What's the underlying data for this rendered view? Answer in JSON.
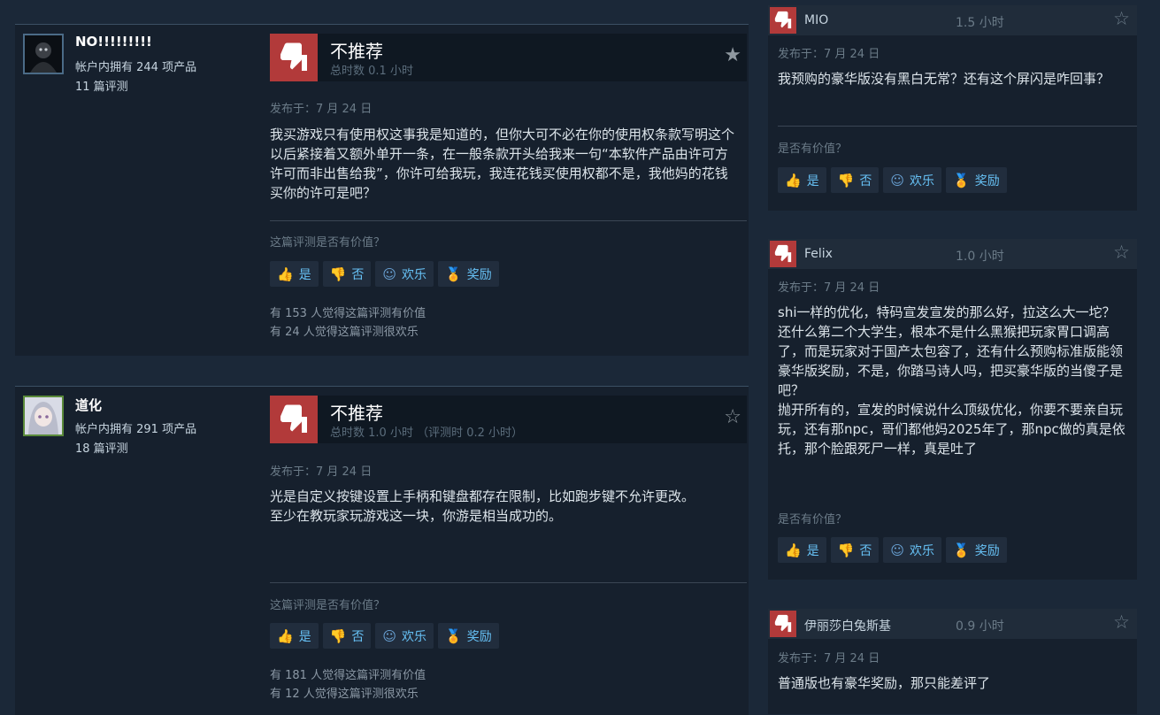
{
  "reviews": [
    {
      "user": "NO!!!!!!!!!",
      "products": "帐户内拥有 244 项产品",
      "review_count": "11 篇评测",
      "verdict": "不推荐",
      "hours": "总时数 0.1 小时",
      "posted": "发布于：7 月 24 日",
      "body": "我买游戏只有使用权这事我是知道的，但你大可不必在你的使用权条款写明这个以后紧接着又额外单开一条，在一般条款开头给我来一句“本软件产品由许可方许可而非出售给我”，你许可给我玩，我连花钱买使用权都不是，我他妈的花钱买你的许可是吧？",
      "helpful_q": "这篇评测是否有价值？",
      "helpful_stat": "有 153 人觉得这篇评测有价值",
      "funny_stat": "有 24 人觉得这篇评测很欢乐"
    },
    {
      "user": "道化",
      "products": "帐户内拥有 291 项产品",
      "review_count": "18 篇评测",
      "verdict": "不推荐",
      "hours": "总时数 1.0 小时 （评测时 0.2 小时）",
      "posted": "发布于：7 月 24 日",
      "body": "光是自定义按键设置上手柄和键盘都存在限制，比如跑步键不允许更改。\n至少在教玩家玩游戏这一块，你游是相当成功的。",
      "helpful_q": "这篇评测是否有价值？",
      "helpful_stat": "有 181 人觉得这篇评测有价值",
      "funny_stat": "有 12 人觉得这篇评测很欢乐"
    }
  ],
  "side_reviews": [
    {
      "user": "MIO",
      "hours": "1.5 小时",
      "posted": "发布于：7 月 24 日",
      "body": "我预购的豪华版没有黑白无常？还有这个屏闪是咋回事？",
      "helpful_q": "是否有价值？"
    },
    {
      "user": "Felix",
      "hours": "1.0 小时",
      "posted": "发布于：7 月 24 日",
      "body": "shi一样的优化，特码宣发宣发的那么好，拉这么大一坨？还什么第二个大学生，根本不是什么黑猴把玩家胃口调高了，而是玩家对于国产太包容了，还有什么预购标准版能领豪华版奖励，不是，你踏马诗人吗，把买豪华版的当傻子是吧？\n抛开所有的，宣发的时候说什么顶级优化，你要不要亲自玩玩，还有那npc，哥们都他妈2025年了，那npc做的真是依托，那个脸跟死尸一样，真是吐了",
      "helpful_q": "是否有价值？"
    },
    {
      "user": "伊丽莎白兔斯基",
      "hours": "0.9 小时",
      "posted": "发布于：7 月 24 日",
      "body": "普通版也有豪华奖励，那只能差评了"
    }
  ],
  "buttons": {
    "yes": "是",
    "no": "否",
    "funny": "欢乐",
    "award": "奖励"
  },
  "icons": {
    "thumb_down": "thumbs-down-icon",
    "thumb_up": "thumbs-up-icon",
    "smile": "smile-icon",
    "award": "award-icon",
    "star": "star-icon"
  },
  "colors": {
    "not_recommended": "#b23a3a",
    "link": "#66c0f4",
    "background": "#1b2838"
  }
}
